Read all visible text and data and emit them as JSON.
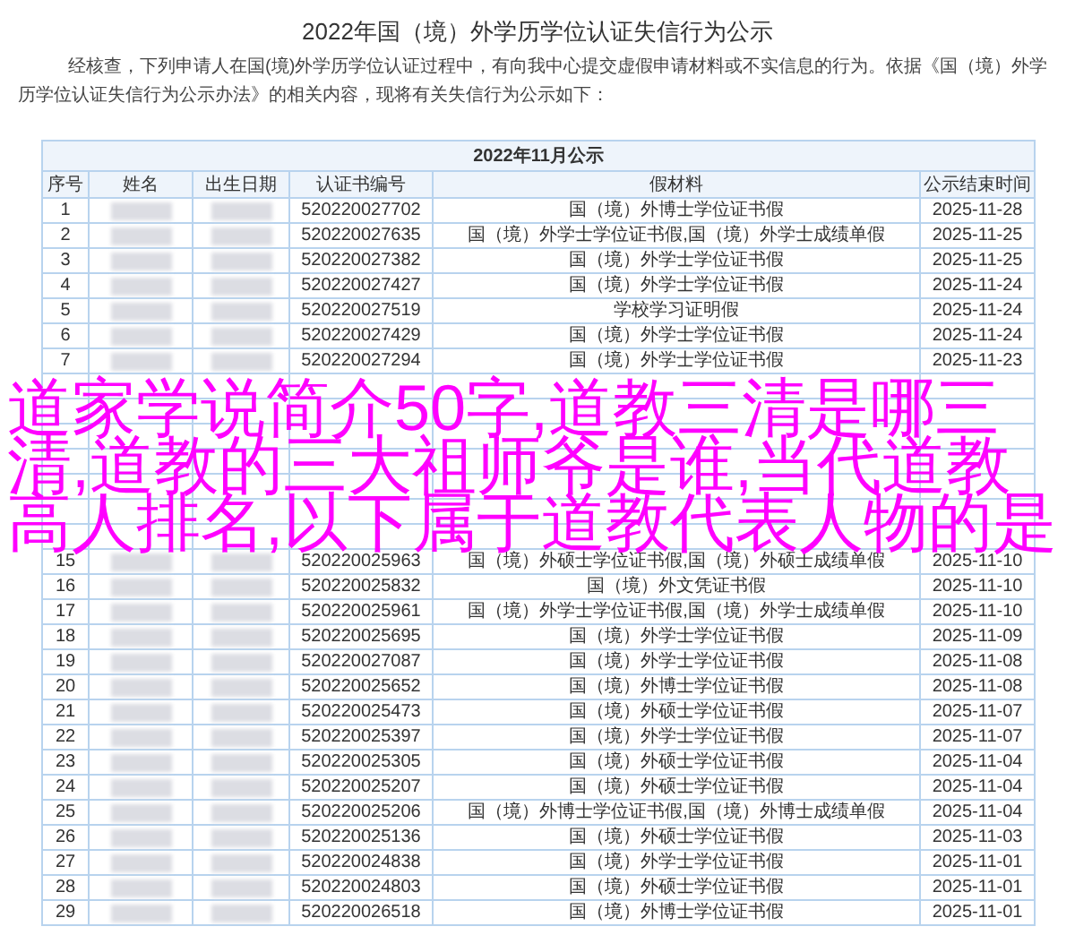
{
  "title": "2022年国（境）外学历学位认证失信行为公示",
  "intro": "经核查，下列申请人在国(境)外学历学位认证过程中，有向我中心提交虚假申请材料或不实信息的行为。依据《国（境）外学历学位认证失信行为公示办法》的相关内容，现将有关失信行为公示如下：",
  "table": {
    "caption": "2022年11月公示",
    "columns": [
      "序号",
      "姓名",
      "出生日期",
      "认证书编号",
      "假材料",
      "公示结束时间"
    ],
    "rows": [
      {
        "seq": "1",
        "cert": "520220027702",
        "material": "国（境）外博士学位证书假",
        "end": "2025-11-28"
      },
      {
        "seq": "2",
        "cert": "520220027635",
        "material": "国（境）外学士学位证书假,国（境）外学士成绩单假",
        "end": "2025-11-25"
      },
      {
        "seq": "3",
        "cert": "520220027382",
        "material": "国（境）外学士学位证书假",
        "end": "2025-11-25"
      },
      {
        "seq": "4",
        "cert": "520220027427",
        "material": "国（境）外学士学位证书假",
        "end": "2025-11-24"
      },
      {
        "seq": "5",
        "cert": "520220027519",
        "material": "学校学习证明假",
        "end": "2025-11-24"
      },
      {
        "seq": "6",
        "cert": "520220027429",
        "material": "国（境）外学士学位证书假",
        "end": "2025-11-24"
      },
      {
        "seq": "7",
        "cert": "520220027294",
        "material": "国（境）外学士学位证书假",
        "end": "2025-11-23"
      },
      {
        "covered": true
      },
      {
        "covered": true
      },
      {
        "covered": true
      },
      {
        "covered": true
      },
      {
        "covered": true
      },
      {
        "covered": true
      },
      {
        "covered": true
      },
      {
        "seq": "15",
        "cert": "520220025963",
        "material": "国（境）外硕士学位证书假,国（境）外硕士成绩单假",
        "end": "2025-11-10"
      },
      {
        "seq": "16",
        "cert": "520220025832",
        "material": "国（境）外文凭证书假",
        "end": "2025-11-10"
      },
      {
        "seq": "17",
        "cert": "520220025961",
        "material": "国（境）外学士学位证书假,国（境）外学士成绩单假",
        "end": "2025-11-10"
      },
      {
        "seq": "18",
        "cert": "520220025695",
        "material": "国（境）外学士学位证书假",
        "end": "2025-11-09"
      },
      {
        "seq": "19",
        "cert": "520220027087",
        "material": "国（境）外学士学位证书假",
        "end": "2025-11-08"
      },
      {
        "seq": "20",
        "cert": "520220025652",
        "material": "国（境）外博士学位证书假",
        "end": "2025-11-08"
      },
      {
        "seq": "21",
        "cert": "520220025473",
        "material": "国（境）外硕士学位证书假",
        "end": "2025-11-07"
      },
      {
        "seq": "22",
        "cert": "520220025397",
        "material": "国（境）外学士学位证书假",
        "end": "2025-11-07"
      },
      {
        "seq": "23",
        "cert": "520220025305",
        "material": "国（境）外硕士学位证书假",
        "end": "2025-11-04"
      },
      {
        "seq": "24",
        "cert": "520220025207",
        "material": "国（境）外硕士学位证书假",
        "end": "2025-11-04"
      },
      {
        "seq": "25",
        "cert": "520220025206",
        "material": "国（境）外博士学位证书假,国（境）外博士成绩单假",
        "end": "2025-11-04"
      },
      {
        "seq": "26",
        "cert": "520220025136",
        "material": "国（境）外硕士学位证书假",
        "end": "2025-11-03"
      },
      {
        "seq": "27",
        "cert": "520220024838",
        "material": "国（境）外学士学位证书假",
        "end": "2025-11-01"
      },
      {
        "seq": "28",
        "cert": "520220024803",
        "material": "国（境）外硕士学位证书假",
        "end": "2025-11-01"
      },
      {
        "seq": "29",
        "cert": "520220026518",
        "material": "国（境）外博士学位证书假",
        "end": "2025-11-01"
      }
    ]
  },
  "overlay_headline": "道家学说简介50字,道教三清是哪三清,道教的三大祖师爷是谁,当代道教高人排名,以下属于道教代表人物的是"
}
